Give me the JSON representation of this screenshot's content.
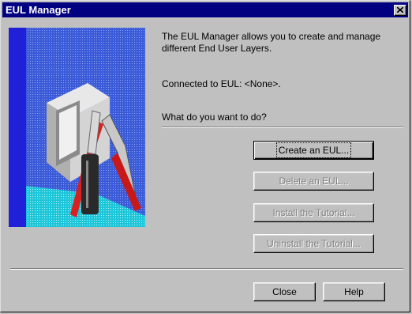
{
  "window": {
    "title": "EUL Manager",
    "close_icon": "close-icon"
  },
  "content": {
    "description": "The EUL Manager allows you to create and manage different End User Layers.",
    "connected": "Connected to EUL: <None>.",
    "question": "What do you want to do?"
  },
  "buttons": {
    "create": "Create an EUL...",
    "delete": "Delete an EUL...",
    "install": "Install the Tutorial...",
    "uninstall": "Uninstall the Tutorial...",
    "close": "Close",
    "help": "Help"
  },
  "colors": {
    "titlebar": "#000080",
    "face": "#c0c0c0",
    "disabled_text": "#808080"
  }
}
